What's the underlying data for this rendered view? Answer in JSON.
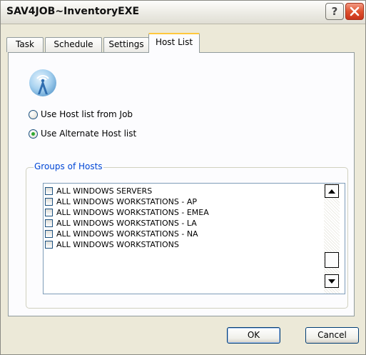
{
  "window": {
    "title": "SAV4JOB~InventoryEXE",
    "help_glyph": "?",
    "close_label": "close"
  },
  "tabs": [
    {
      "label": "Task"
    },
    {
      "label": "Schedule"
    },
    {
      "label": "Settings"
    },
    {
      "label": "Host List",
      "selected": true
    }
  ],
  "host_source": {
    "icon": "antenna-icon",
    "options": [
      {
        "label": "Use Host list from Job",
        "checked": false
      },
      {
        "label": "Use Alternate Host list",
        "checked": true
      }
    ]
  },
  "groups": {
    "legend": "Groups of Hosts",
    "items": [
      {
        "label": "ALL WINDOWS SERVERS",
        "checked": false
      },
      {
        "label": "ALL WINDOWS WORKSTATIONS - AP",
        "checked": false
      },
      {
        "label": "ALL WINDOWS WORKSTATIONS - EMEA",
        "checked": false
      },
      {
        "label": "ALL WINDOWS WORKSTATIONS - LA",
        "checked": false
      },
      {
        "label": "ALL WINDOWS WORKSTATIONS - NA",
        "checked": false
      },
      {
        "label": "ALL WINDOWS WORKSTATIONS",
        "checked": false
      }
    ]
  },
  "buttons": {
    "ok": "OK",
    "cancel": "Cancel"
  },
  "colors": {
    "tab_highlight": "#ffc83c",
    "group_legend": "#0046d5",
    "radio_dot": "#2fa82f",
    "close_button": "#e0522e"
  }
}
